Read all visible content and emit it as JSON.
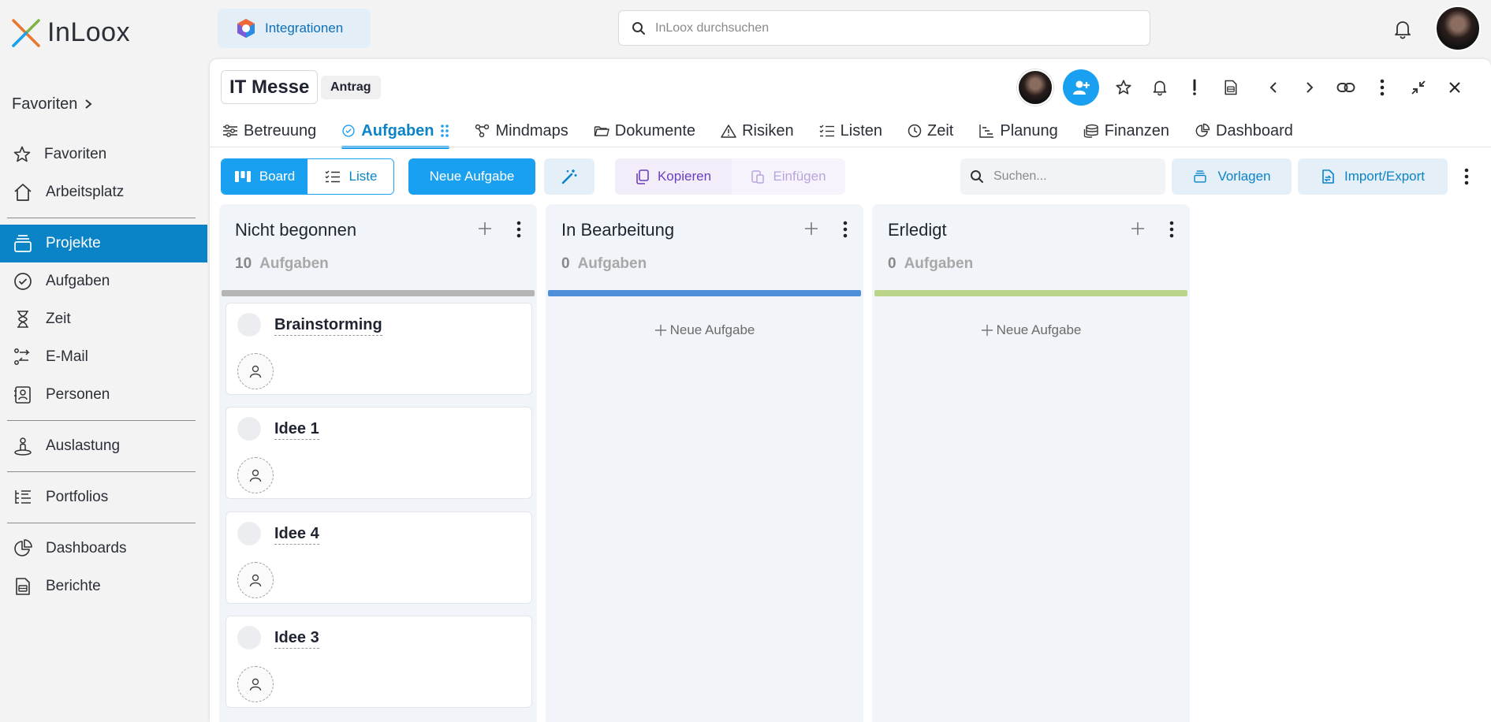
{
  "app": {
    "brand": "InLoox",
    "integrations_label": "Integrationen",
    "search_placeholder": "InLoox durchsuchen"
  },
  "sidebar": {
    "favorites_header": "Favoriten",
    "items": [
      {
        "label": "Favoriten",
        "icon": "star-icon"
      },
      {
        "label": "Arbeitsplatz",
        "icon": "home-icon"
      },
      {
        "label": "Projekte",
        "icon": "projects-icon"
      },
      {
        "label": "Aufgaben",
        "icon": "check-circle-icon"
      },
      {
        "label": "Zeit",
        "icon": "hourglass-icon"
      },
      {
        "label": "E-Mail",
        "icon": "email-flow-icon"
      },
      {
        "label": "Personen",
        "icon": "contact-card-icon"
      },
      {
        "label": "Auslastung",
        "icon": "person-pin-icon"
      },
      {
        "label": "Portfolios",
        "icon": "portfolio-list-icon"
      },
      {
        "label": "Dashboards",
        "icon": "pie-chart-icon"
      },
      {
        "label": "Berichte",
        "icon": "report-icon"
      }
    ],
    "active": "Projekte"
  },
  "project": {
    "title": "IT Messe",
    "status": "Antrag"
  },
  "tabs": [
    {
      "label": "Betreuung",
      "icon": "sliders-icon"
    },
    {
      "label": "Aufgaben",
      "icon": "check-circle-icon"
    },
    {
      "label": "Mindmaps",
      "icon": "mindmap-icon"
    },
    {
      "label": "Dokumente",
      "icon": "folder-icon"
    },
    {
      "label": "Risiken",
      "icon": "warning-icon"
    },
    {
      "label": "Listen",
      "icon": "checklist-icon"
    },
    {
      "label": "Zeit",
      "icon": "clock-icon"
    },
    {
      "label": "Planung",
      "icon": "gantt-icon"
    },
    {
      "label": "Finanzen",
      "icon": "coins-icon"
    },
    {
      "label": "Dashboard",
      "icon": "pie-chart-icon"
    }
  ],
  "active_tab": "Aufgaben",
  "toolbar": {
    "board_label": "Board",
    "list_label": "Liste",
    "new_task_label": "Neue Aufgabe",
    "copy_label": "Kopieren",
    "paste_label": "Einfügen",
    "search_placeholder": "Suchen...",
    "templates_label": "Vorlagen",
    "import_export_label": "Import/Export"
  },
  "board": {
    "tasks_label": "Aufgaben",
    "add_task_label": "Neue Aufgabe",
    "columns": [
      {
        "title": "Nicht begonnen",
        "count": "10",
        "color": "#b5b5b5",
        "cards": [
          "Brainstorming",
          "Idee 1",
          "Idee 4",
          "Idee 3"
        ]
      },
      {
        "title": "In Bearbeitung",
        "count": "0",
        "color": "#4e8fd9",
        "cards": []
      },
      {
        "title": "Erledigt",
        "count": "0",
        "color": "#bad58a",
        "cards": []
      }
    ]
  },
  "colors": {
    "accent": "#1aa0f0",
    "sidebar_active": "#0b83c7"
  }
}
